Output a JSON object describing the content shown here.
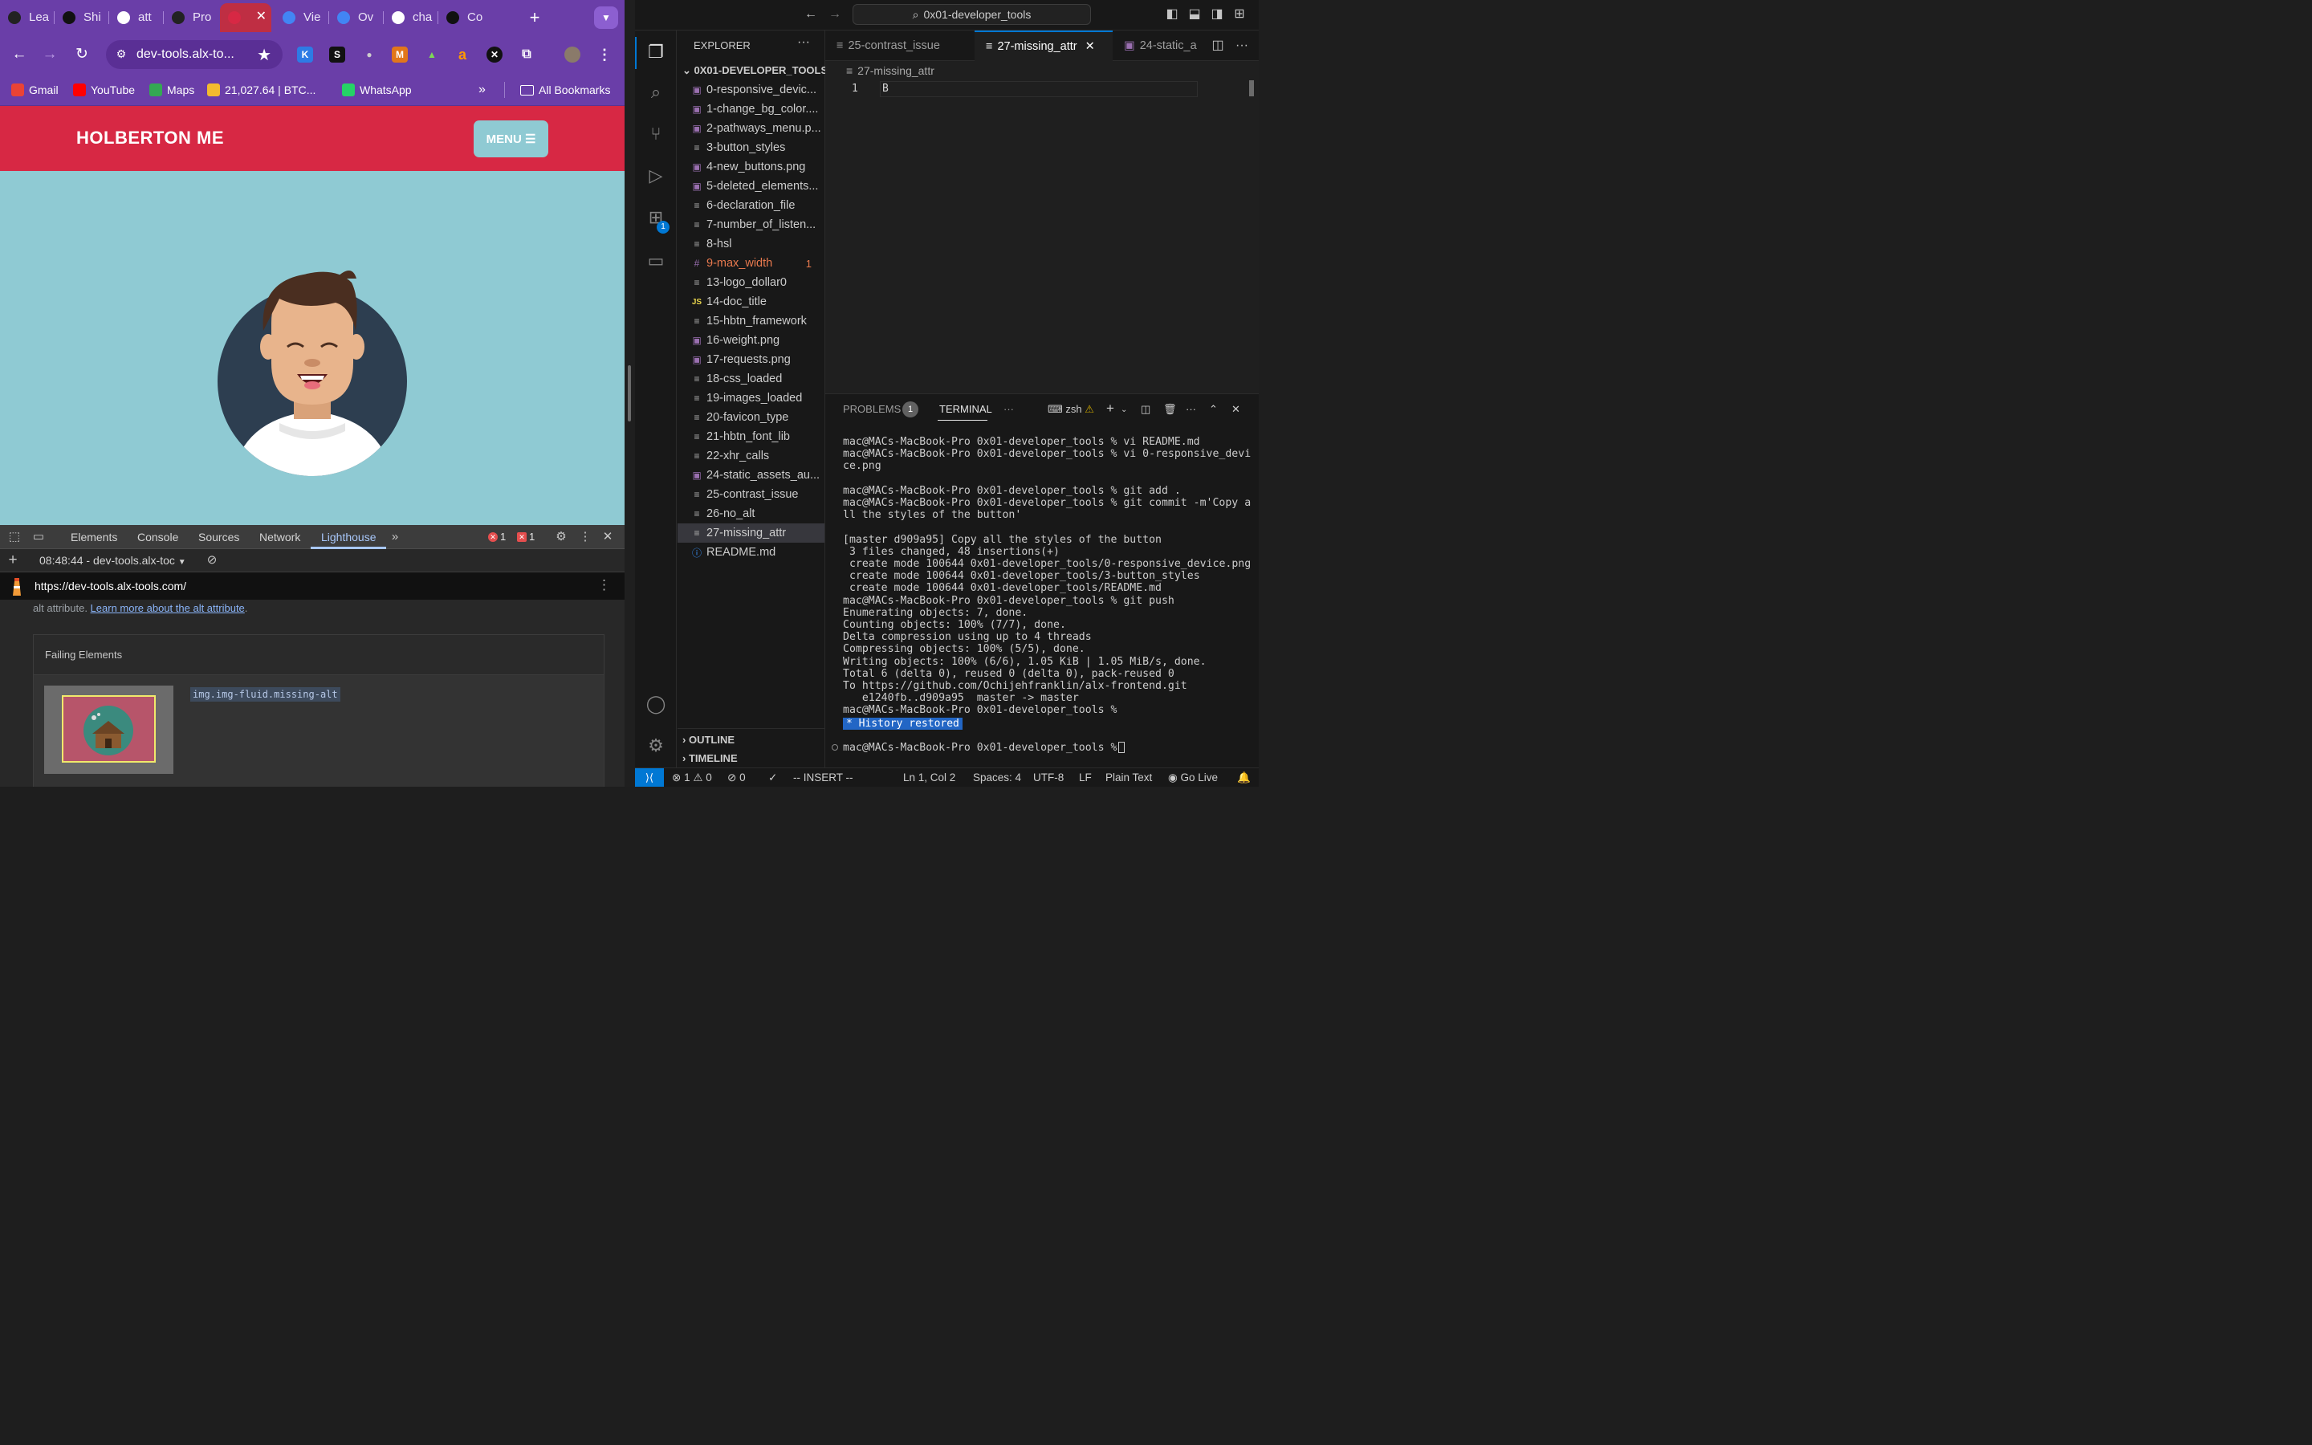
{
  "browser": {
    "tabs": [
      {
        "label": "Lea",
        "icon": "alx",
        "color": "#222"
      },
      {
        "label": "Shi",
        "icon": "github",
        "color": "#111"
      },
      {
        "label": "att",
        "icon": "google",
        "color": "#fff"
      },
      {
        "label": "Pro",
        "icon": "alx",
        "color": "#222"
      },
      {
        "label": "",
        "icon": "holberton",
        "color": "#d72844",
        "active": true
      },
      {
        "label": "Vie",
        "icon": "chrome",
        "color": "#4285f4"
      },
      {
        "label": "Ov",
        "icon": "chrome",
        "color": "#4285f4"
      },
      {
        "label": "cha",
        "icon": "openai",
        "color": "#fff"
      },
      {
        "label": "Co",
        "icon": "cursor",
        "color": "#111"
      }
    ],
    "omnibox_url": "dev-tools.alx-to...",
    "bookmarks": [
      {
        "label": "Gmail",
        "icon": "gmail",
        "color": "#ea4335"
      },
      {
        "label": "YouTube",
        "icon": "youtube",
        "color": "#ff0000"
      },
      {
        "label": "Maps",
        "icon": "maps",
        "color": "#34a853"
      },
      {
        "label": "21,027.64 | BTC...",
        "icon": "binance",
        "color": "#f3ba2f"
      },
      {
        "label": "WhatsApp",
        "icon": "whatsapp",
        "color": "#25d366"
      }
    ],
    "all_bookmarks": "All Bookmarks",
    "site": {
      "logo": "HOLBERTON ME",
      "menu": "MENU ☰",
      "bg": "#8fcad3",
      "bar": "#d72844"
    },
    "devtools": {
      "tabs": [
        "Elements",
        "Console",
        "Sources",
        "Network",
        "Lighthouse"
      ],
      "err_count": "1",
      "issue_count": "1",
      "report": "08:48:44 - dev-tools.alx-toc",
      "report_url": "https://dev-tools.alx-tools.com/",
      "text_prefix": "alt attribute. ",
      "learn_more": "Learn more about the alt attribute",
      "text_suffix": ".",
      "failing_title": "Failing Elements",
      "failing_selector": "img.img-fluid.missing-alt"
    }
  },
  "vscode": {
    "search": "0x01-developer_tools",
    "explorer": "EXPLORER",
    "folder": "0X01-DEVELOPER_TOOLS",
    "files": [
      {
        "name": "0-responsive_devic...",
        "type": "img"
      },
      {
        "name": "1-change_bg_color....",
        "type": "img"
      },
      {
        "name": "2-pathways_menu.p...",
        "type": "img"
      },
      {
        "name": "3-button_styles",
        "type": "txt"
      },
      {
        "name": "4-new_buttons.png",
        "type": "img"
      },
      {
        "name": "5-deleted_elements...",
        "type": "img"
      },
      {
        "name": "6-declaration_file",
        "type": "txt"
      },
      {
        "name": "7-number_of_listen...",
        "type": "txt"
      },
      {
        "name": "8-hsl",
        "type": "txt"
      },
      {
        "name": "9-max_width",
        "type": "css",
        "count": "1"
      },
      {
        "name": "13-logo_dollar0",
        "type": "txt"
      },
      {
        "name": "14-doc_title",
        "type": "js"
      },
      {
        "name": "15-hbtn_framework",
        "type": "txt"
      },
      {
        "name": "16-weight.png",
        "type": "img"
      },
      {
        "name": "17-requests.png",
        "type": "img"
      },
      {
        "name": "18-css_loaded",
        "type": "txt"
      },
      {
        "name": "19-images_loaded",
        "type": "txt"
      },
      {
        "name": "20-favicon_type",
        "type": "txt"
      },
      {
        "name": "21-hbtn_font_lib",
        "type": "txt"
      },
      {
        "name": "22-xhr_calls",
        "type": "txt"
      },
      {
        "name": "24-static_assets_au...",
        "type": "img"
      },
      {
        "name": "25-contrast_issue",
        "type": "txt"
      },
      {
        "name": "26-no_alt",
        "type": "txt"
      },
      {
        "name": "27-missing_attr",
        "type": "txt",
        "selected": true
      },
      {
        "name": "README.md",
        "type": "info"
      }
    ],
    "outline": "OUTLINE",
    "timeline": "TIMELINE",
    "editor_tabs": [
      "25-contrast_issue",
      "27-missing_attr",
      "24-static_a"
    ],
    "breadcrumb": "27-missing_attr",
    "line_no": "1",
    "line_text": "B",
    "panel_tabs": {
      "problems": "PROBLEMS",
      "problems_count": "1",
      "terminal": "TERMINAL",
      "shell": "zsh"
    },
    "terminal_text": "mac@MACs-MacBook-Pro 0x01-developer_tools % vi README.md\nmac@MACs-MacBook-Pro 0x01-developer_tools % vi 0-responsive_device.png\n\nmac@MACs-MacBook-Pro 0x01-developer_tools % git add .\nmac@MACs-MacBook-Pro 0x01-developer_tools % git commit -m'Copy all the styles of the button'\n\n[master d909a95] Copy all the styles of the button\n 3 files changed, 48 insertions(+)\n create mode 100644 0x01-developer_tools/0-responsive_device.png\n create mode 100644 0x01-developer_tools/3-button_styles\n create mode 100644 0x01-developer_tools/README.md\nmac@MACs-MacBook-Pro 0x01-developer_tools % git push\nEnumerating objects: 7, done.\nCounting objects: 100% (7/7), done.\nDelta compression using up to 4 threads\nCompressing objects: 100% (5/5), done.\nWriting objects: 100% (6/6), 1.05 KiB | 1.05 MiB/s, done.\nTotal 6 (delta 0), reused 0 (delta 0), pack-reused 0\nTo https://github.com/Ochijehfranklin/alx-frontend.git\n   e1240fb..d909a95  master -> master\nmac@MACs-MacBook-Pro 0x01-developer_tools %",
    "history_restored": "* History restored",
    "prompt": "mac@MACs-MacBook-Pro 0x01-developer_tools %",
    "status": {
      "errors": "1",
      "warnings": "0",
      "ports": "0",
      "mode": "-- INSERT --",
      "position": "Ln 1, Col 2",
      "spaces": "Spaces: 4",
      "encoding": "UTF-8",
      "eol": "LF",
      "lang": "Plain Text",
      "golive": "Go Live"
    }
  }
}
